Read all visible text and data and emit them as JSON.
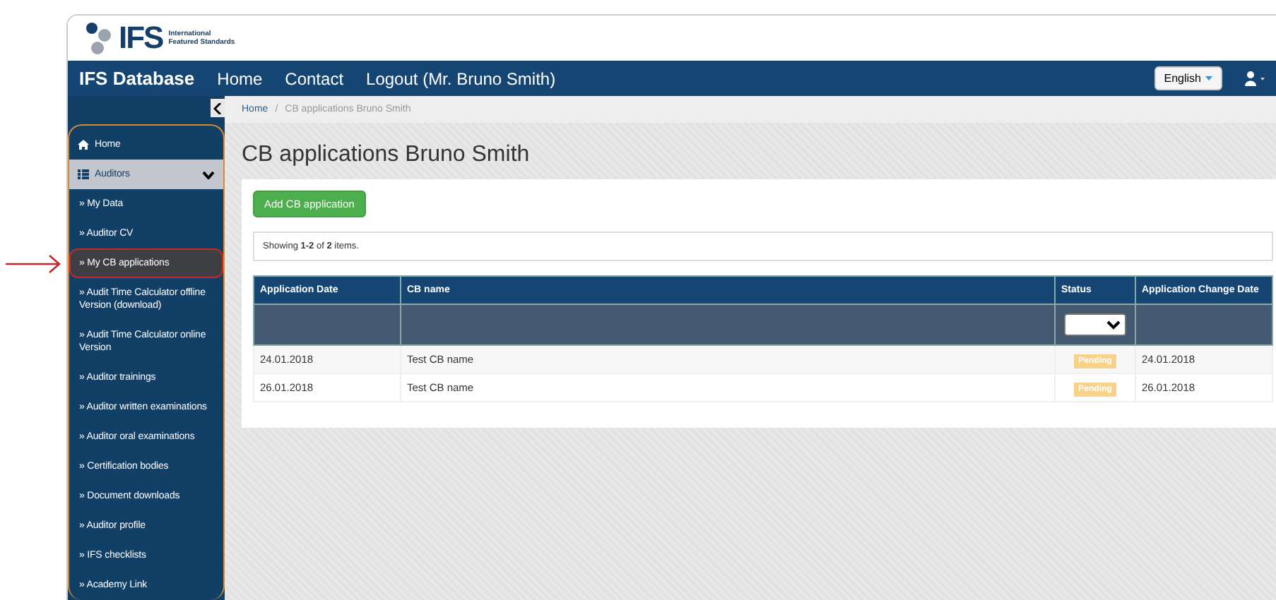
{
  "logo": {
    "mark": "IFS",
    "tagline": [
      "International",
      "Featured Standards"
    ]
  },
  "navbar": {
    "brand": "IFS Database",
    "links": [
      "Home",
      "Contact",
      "Logout (Mr. Bruno Smith)"
    ],
    "language": "English"
  },
  "sidebar": {
    "menu": [
      {
        "kind": "link",
        "label": "Home",
        "selected": false
      },
      {
        "kind": "group",
        "label": "Auditors",
        "selected": false,
        "expanded": true,
        "children": [
          {
            "label": "» My Data",
            "selected": false
          },
          {
            "label": "» Auditor CV",
            "selected": false
          },
          {
            "label": "» My CB applications",
            "selected": true
          },
          {
            "label": "» Audit Time Calculator offline Version (download)",
            "selected": false
          },
          {
            "label": "» Audit Time Calculator online Version",
            "selected": false
          },
          {
            "label": "» Auditor trainings",
            "selected": false
          },
          {
            "label": "» Auditor written examinations",
            "selected": false
          },
          {
            "label": "» Auditor oral examinations",
            "selected": false
          },
          {
            "label": "» Certification bodies",
            "selected": false
          },
          {
            "label": "» Document downloads",
            "selected": false
          },
          {
            "label": "» Auditor profile",
            "selected": false
          },
          {
            "label": "» IFS checklists",
            "selected": false
          },
          {
            "label": "» Academy Link",
            "selected": false
          }
        ]
      }
    ]
  },
  "breadcrumb": [
    "Home",
    "CB applications Bruno Smith"
  ],
  "breadcrumb_separator": "/",
  "title": "CB applications Bruno Smith",
  "add_button": "Add CB application",
  "summary": "Showing **1-2** of **2** items.",
  "table": {
    "columns": [
      "Application Date",
      "CB name",
      "Status",
      "Application Change Date"
    ],
    "rows": [
      {
        "application_date": "24.01.2018",
        "cb_name": "Test CB name",
        "status": "Pending",
        "change_date": "24.01.2018"
      },
      {
        "application_date": "26.01.2018",
        "cb_name": "Test CB name",
        "status": "Pending",
        "change_date": "26.01.2018"
      }
    ]
  }
}
